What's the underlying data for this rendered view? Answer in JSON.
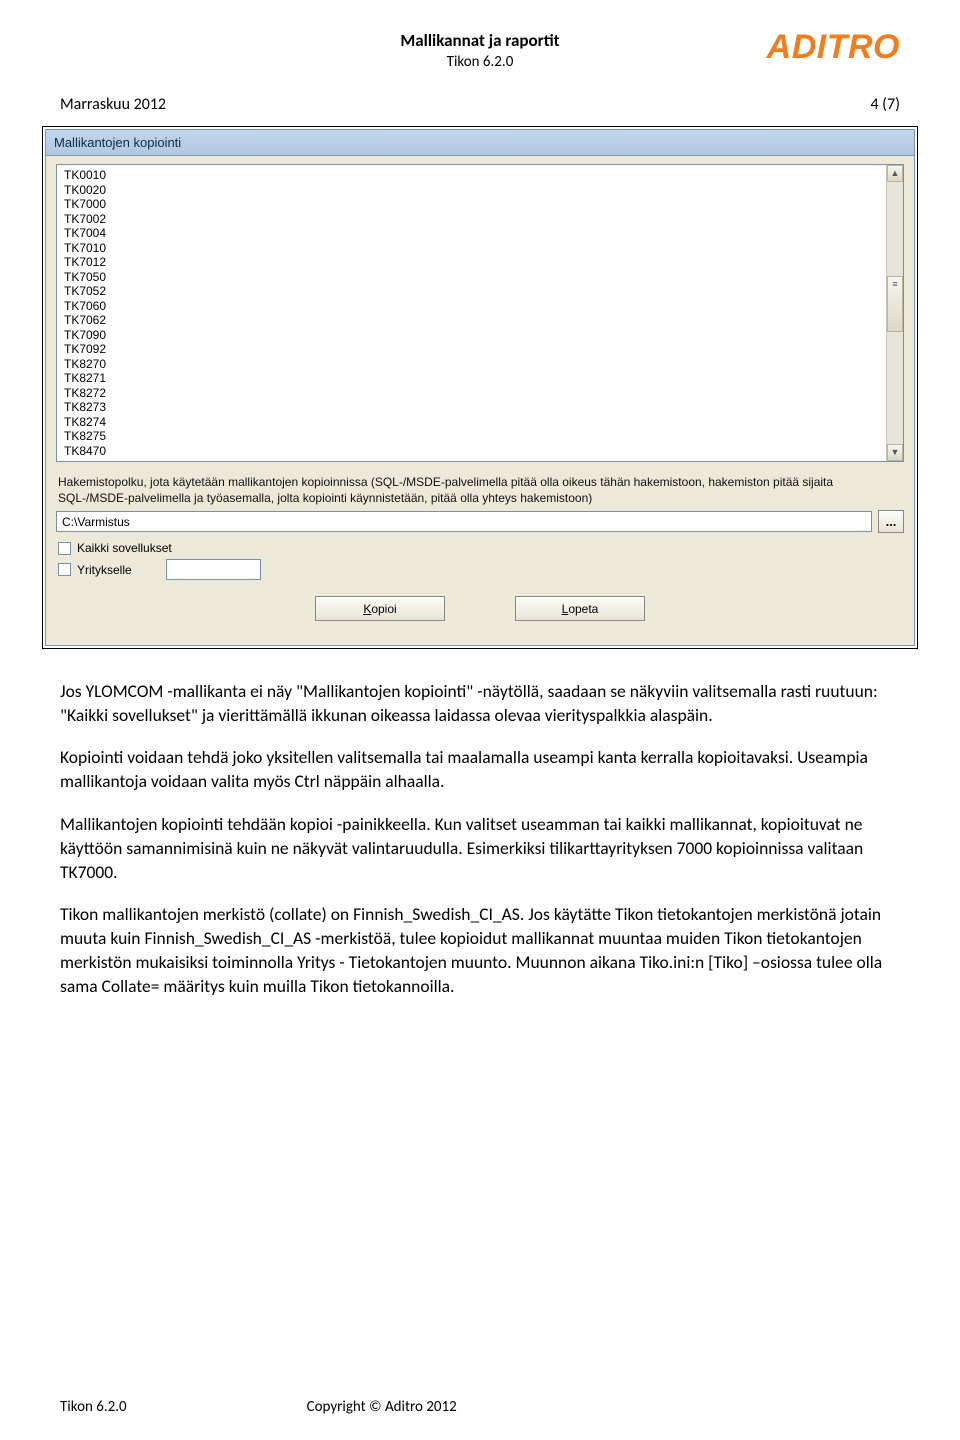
{
  "header": {
    "title": "Mallikannat ja raportit",
    "subtitle": "Tikon 6.2.0",
    "logo": "ADITRO"
  },
  "meta": {
    "date": "Marraskuu 2012",
    "page": "4 (7)"
  },
  "window": {
    "title": "Mallikantojen kopiointi",
    "list": [
      "TK0010",
      "TK0020",
      "TK7000",
      "TK7002",
      "TK7004",
      "TK7010",
      "TK7012",
      "TK7050",
      "TK7052",
      "TK7060",
      "TK7062",
      "TK7090",
      "TK7092",
      "TK8270",
      "TK8271",
      "TK8272",
      "TK8273",
      "TK8274",
      "TK8275",
      "TK8470"
    ],
    "help": "Hakemistopolku, jota käytetään mallikantojen kopioinnissa (SQL-/MSDE-palvelimella pitää olla oikeus tähän hakemistoon, hakemiston pitää sijaita SQL-/MSDE-palvelimella ja työasemalla, jolta kopiointi käynnistetään, pitää olla yhteys hakemistoon)",
    "path": "C:\\Varmistus",
    "browse": "...",
    "chk_all": "Kaikki sovellukset",
    "chk_company": "Yritykselle",
    "btn_copy_pre": "K",
    "btn_copy_rest": "opioi",
    "btn_quit_pre": "L",
    "btn_quit_rest": "opeta"
  },
  "body": {
    "p1": "Jos YLOMCOM -mallikanta ei näy \"Mallikantojen kopiointi\" -näytöllä, saadaan se näkyviin valitsemalla rasti ruutuun: \"Kaikki sovellukset\" ja vierittämällä ikkunan oikeassa laidassa olevaa vierityspalkkia alaspäin.",
    "p2": "Kopiointi voidaan tehdä joko yksitellen valitsemalla tai maalamalla useampi kanta kerralla kopioitavaksi. Useampia mallikantoja voidaan valita myös Ctrl näppäin alhaalla.",
    "p3": "Mallikantojen kopiointi tehdään kopioi -painikkeella. Kun valitset useamman tai kaikki mallikannat, kopioituvat ne käyttöön samannimisinä kuin ne näkyvät valintaruudulla. Esimerkiksi tilikarttayrityksen 7000 kopioinnissa valitaan TK7000.",
    "p4": "Tikon mallikantojen merkistö (collate) on Finnish_Swedish_CI_AS. Jos käytätte Tikon tietokantojen merkistönä jotain muuta kuin Finnish_Swedish_CI_AS -merkistöä, tulee kopioidut mallikannat muuntaa muiden Tikon tietokantojen merkistön mukaisiksi toiminnolla Yritys - Tietokantojen muunto. Muunnon aikana Tiko.ini:n [Tiko] –osiossa tulee olla sama Collate= määritys kuin muilla Tikon tietokannoilla."
  },
  "footer": {
    "left": "Tikon 6.2.0",
    "right": "Copyright © Aditro 2012"
  }
}
